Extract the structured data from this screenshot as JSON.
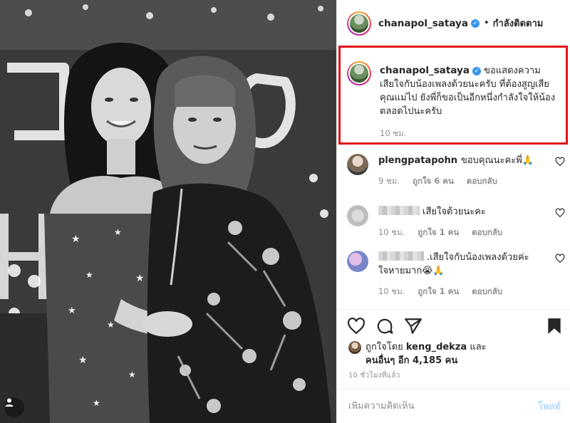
{
  "post": {
    "username": "chanapol_sataya",
    "follow_status": "กำลังติดตาม",
    "separator": "•"
  },
  "caption": {
    "username": "chanapol_sataya",
    "text": "ขอแสดงความเสียใจกับน้องเพลงด้วยนะครับ ที่ต้องสูญเสียคุณแม่ไป ยังพี่ก็ขอเป็นอีกหนึ่งกำลังใจให้น้องตลอดไปนะครับ",
    "time": "10 ชม.",
    "highlight_color": "#e0121b"
  },
  "comments": [
    {
      "username": "plengpatapohn",
      "text": "ขอบคุณนะคะพี่🙏",
      "time": "9 ชม.",
      "likes": "ถูกใจ 6 คน",
      "reply": "ตอบกลับ"
    },
    {
      "username": "",
      "text": "เสียใจด้วยนะคะ",
      "time": "10 ชม.",
      "likes": "ถูกใจ 1 คน",
      "reply": "ตอบกลับ"
    },
    {
      "username": "",
      "text": ".เสียใจกับน้องเพลงด้วยค่ะ ใจหายมาก😭🙏",
      "time": "10 ชม.",
      "likes": "ถูกใจ 1 คน",
      "reply": "ตอบกลับ"
    }
  ],
  "likes": {
    "prefix": "ถูกใจโดย",
    "first_user": "keng_dekza",
    "conj": "และ",
    "others": "คนอื่นๆ อีก 4,185 คน"
  },
  "post_age": "10 ชั่วโมงที่แล้ว",
  "add_comment": {
    "placeholder": "เพิ่มความคิดเห็น",
    "post_label": "โพสต์"
  },
  "colors": {
    "verified": "#3897f0",
    "post_button_disabled": "#b3dbff",
    "secondary_text": "#8e8e8e"
  },
  "icons": [
    "verified-badge-icon",
    "heart-icon",
    "comment-icon",
    "share-icon",
    "bookmark-icon",
    "user-tag-icon"
  ]
}
